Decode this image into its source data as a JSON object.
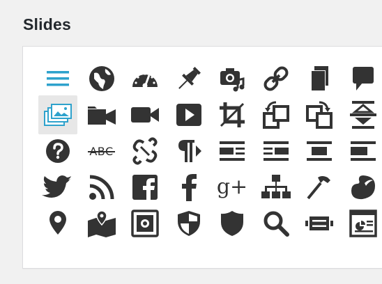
{
  "section": {
    "title": "Slides"
  },
  "colors": {
    "icon": "#333333",
    "accent": "#2ea2cc",
    "selected_bg": "#e7e7e7",
    "panel_bg": "#ffffff",
    "page_bg": "#f1f1f1"
  },
  "icons": [
    {
      "name": "menu-icon",
      "selected": false
    },
    {
      "name": "globe-icon",
      "selected": false
    },
    {
      "name": "dashboard-gauge-icon",
      "selected": false
    },
    {
      "name": "pin-icon",
      "selected": false
    },
    {
      "name": "camera-music-icon",
      "selected": false
    },
    {
      "name": "link-icon",
      "selected": false
    },
    {
      "name": "pages-icon",
      "selected": false
    },
    {
      "name": "speech-bubble-icon",
      "selected": false
    },
    {
      "name": "images-stack-icon",
      "selected": true
    },
    {
      "name": "video-folder-icon",
      "selected": false
    },
    {
      "name": "video-camera-icon",
      "selected": false
    },
    {
      "name": "play-button-icon",
      "selected": false
    },
    {
      "name": "crop-icon",
      "selected": false
    },
    {
      "name": "rotate-left-icon",
      "selected": false
    },
    {
      "name": "rotate-right-icon",
      "selected": false
    },
    {
      "name": "flip-vertical-icon",
      "selected": false
    },
    {
      "name": "help-icon",
      "selected": false
    },
    {
      "name": "strikethrough-icon",
      "selected": false,
      "text": "ABC"
    },
    {
      "name": "unlink-icon",
      "selected": false
    },
    {
      "name": "paragraph-ltr-icon",
      "selected": false
    },
    {
      "name": "align-left-icon",
      "selected": false
    },
    {
      "name": "align-right-icon",
      "selected": false
    },
    {
      "name": "align-center-icon",
      "selected": false
    },
    {
      "name": "align-none-icon",
      "selected": false
    },
    {
      "name": "twitter-icon",
      "selected": false
    },
    {
      "name": "rss-icon",
      "selected": false
    },
    {
      "name": "facebook-square-icon",
      "selected": false
    },
    {
      "name": "facebook-icon",
      "selected": false
    },
    {
      "name": "google-plus-icon",
      "selected": false,
      "text": "g+"
    },
    {
      "name": "sitemap-icon",
      "selected": false
    },
    {
      "name": "hammer-icon",
      "selected": false
    },
    {
      "name": "art-palette-icon",
      "selected": false
    },
    {
      "name": "location-pin-icon",
      "selected": false
    },
    {
      "name": "map-location-icon",
      "selected": false
    },
    {
      "name": "vault-icon",
      "selected": false
    },
    {
      "name": "shield-half-icon",
      "selected": false
    },
    {
      "name": "shield-icon",
      "selected": false
    },
    {
      "name": "search-icon",
      "selected": false
    },
    {
      "name": "film-strip-icon",
      "selected": false
    },
    {
      "name": "slides-presentation-icon",
      "selected": false
    }
  ]
}
